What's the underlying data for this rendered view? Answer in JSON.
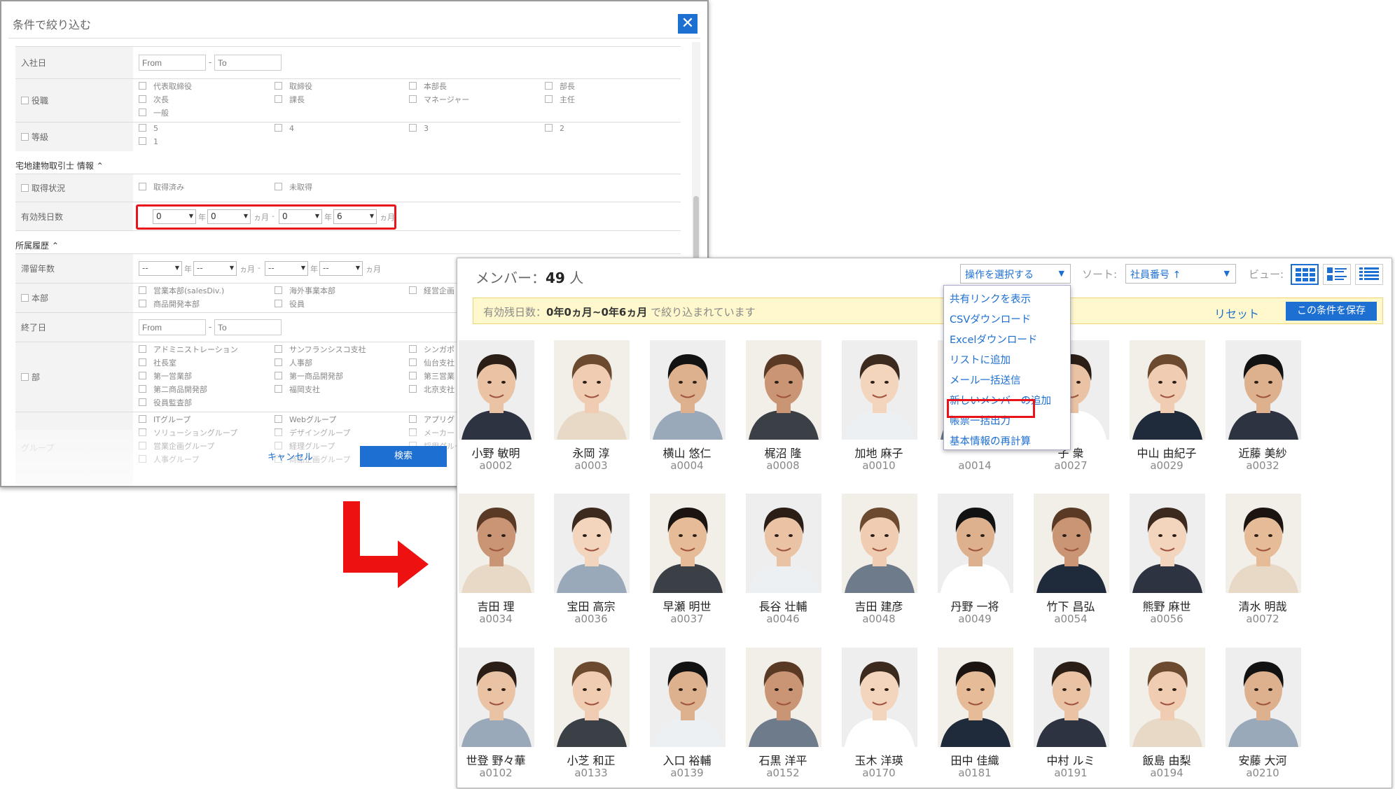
{
  "filter_dialog": {
    "title": "条件で絞り込む",
    "close_icon": "close-icon",
    "rows": {
      "join_date": {
        "label": "入社日",
        "from_placeholder": "From",
        "to_placeholder": "To",
        "dash": "-"
      },
      "position": {
        "label": "役職",
        "options": [
          "代表取締役",
          "取締役",
          "本部長",
          "部長",
          "次長",
          "課長",
          "マネージャー",
          "主任",
          "一般"
        ]
      },
      "grade": {
        "label": "等級",
        "options": [
          "5",
          "4",
          "3",
          "2",
          "1"
        ]
      }
    },
    "section_license": {
      "title": "宅地建物取引士 情報",
      "chevron": "chevron-up-icon"
    },
    "license_rows": {
      "status": {
        "label": "取得状況",
        "options": [
          "取得済み",
          "未取得"
        ]
      },
      "validity": {
        "label": "有効残日数",
        "from_year": "0",
        "from_month": "0",
        "to_year": "0",
        "to_month": "6",
        "unit_year": "年",
        "unit_month": "ヵ月",
        "range_dash": "-"
      }
    },
    "section_history": {
      "title": "所属履歴",
      "chevron": "chevron-up-icon"
    },
    "history_rows": {
      "stay_years": {
        "label": "滞留年数",
        "v1": "--",
        "v2": "--",
        "v3": "--",
        "v4": "--"
      },
      "headquarters": {
        "label": "本部",
        "options": [
          "営業本部(salesDiv.)",
          "海外事業本部",
          "経営企画",
          "商品開発本部",
          "役員"
        ]
      },
      "end_date": {
        "label": "終了日",
        "from_placeholder": "From",
        "to_placeholder": "To"
      },
      "department": {
        "label": "部",
        "options": [
          "アドミニストレーション",
          "サンフランシスコ支社",
          "シンガポ",
          "社長室",
          "人事部",
          "仙台支社",
          "第一営業部",
          "第一商品開発部",
          "第三営業",
          "第二商品開発部",
          "福岡支社",
          "北京支社",
          "役員監査部"
        ]
      },
      "group": {
        "label": "グループ",
        "options": [
          "ITグループ",
          "Webグループ",
          "アプリグ",
          "ソリューショングループ",
          "デザイングループ",
          "メーカー",
          "営業企画グループ",
          "経理グループ",
          "採用グループ",
          "人事グループ",
          "商品企画グループ"
        ]
      }
    },
    "cancel_label": "キャンセル",
    "search_label": "検索"
  },
  "member_panel": {
    "count_label": "メンバー：",
    "count_value": "49",
    "count_unit": "人",
    "action_select": "操作を選択する",
    "sort_label": "ソート:",
    "sort_value": "社員番号 ↑",
    "view_label": "ビュー:",
    "view_icons": [
      "grid-view-icon",
      "detail-list-view-icon",
      "list-view-icon"
    ],
    "filter_bar": {
      "prefix": "有効残日数：",
      "range": "0年0ヵ月~0年6ヵ月",
      "suffix": " で絞り込まれています",
      "reset": "リセット",
      "save": "この条件を保存"
    },
    "action_menu": [
      "共有リンクを表示",
      "CSVダウンロード",
      "Excelダウンロード",
      "リストに追加",
      "メール一括送信",
      "新しいメンバーの追加",
      "帳票一括出力",
      "基本情報の再計算"
    ],
    "members": [
      {
        "name": "小野 敏明",
        "id": "a0002"
      },
      {
        "name": "永岡 淳",
        "id": "a0003"
      },
      {
        "name": "横山 悠仁",
        "id": "a0004"
      },
      {
        "name": "梶沼 隆",
        "id": "a0008"
      },
      {
        "name": "加地 麻子",
        "id": "a0010"
      },
      {
        "name": "",
        "id": "a0014"
      },
      {
        "name": "子 衆",
        "id": "a0027"
      },
      {
        "name": "中山 由紀子",
        "id": "a0029"
      },
      {
        "name": "近藤 美紗",
        "id": "a0032"
      },
      {
        "name": "吉田 理",
        "id": "a0034"
      },
      {
        "name": "宝田 高宗",
        "id": "a0036"
      },
      {
        "name": "早瀬 明世",
        "id": "a0037"
      },
      {
        "name": "長谷 壮輔",
        "id": "a0046"
      },
      {
        "name": "吉田 建彦",
        "id": "a0048"
      },
      {
        "name": "丹野 一将",
        "id": "a0049"
      },
      {
        "name": "竹下 昌弘",
        "id": "a0054"
      },
      {
        "name": "熊野 麻世",
        "id": "a0056"
      },
      {
        "name": "清水 明哉",
        "id": "a0072"
      },
      {
        "name": "世登 野々華",
        "id": "a0102"
      },
      {
        "name": "小芝 和正",
        "id": "a0133"
      },
      {
        "name": "入口 裕輔",
        "id": "a0139"
      },
      {
        "name": "石黒 洋平",
        "id": "a0152"
      },
      {
        "name": "玉木 洋瑛",
        "id": "a0170"
      },
      {
        "name": "田中 佳織",
        "id": "a0181"
      },
      {
        "name": "中村 ルミ",
        "id": "a0191"
      },
      {
        "name": "飯島 由梨",
        "id": "a0194"
      },
      {
        "name": "安藤 大河",
        "id": "a0210"
      }
    ]
  },
  "colors": {
    "accent": "#1d6fd1",
    "highlight": "#e8141b",
    "filter_bar_bg": "#fff8cc"
  }
}
